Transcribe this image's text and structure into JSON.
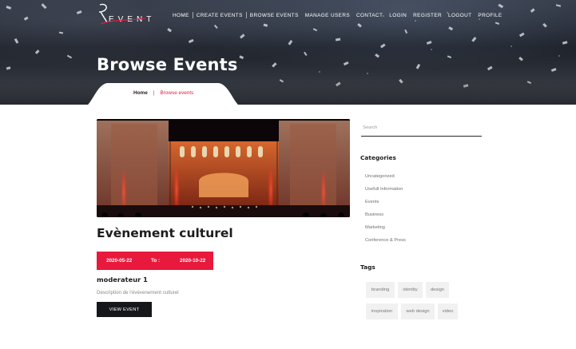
{
  "header": {
    "logo_text": "EVENT",
    "nav": [
      {
        "label": "Home"
      },
      {
        "label": "Create Events"
      },
      {
        "label": "Browse Events"
      },
      {
        "label": "Manage Users"
      },
      {
        "label": "Contact"
      },
      {
        "label": "Login"
      },
      {
        "label": "Register"
      },
      {
        "label": "Logout"
      },
      {
        "label": "Profile"
      }
    ],
    "page_title": "Browse Events",
    "breadcrumb": {
      "home": "Home",
      "separator": "|",
      "current": "Browse events"
    }
  },
  "event": {
    "title": "Evènement culturel",
    "date_start": "2020-05-22",
    "to_label": "To :",
    "date_end": "2020-10-22",
    "moderator": "moderateur 1",
    "description": "Description de l'évévenement culturel",
    "view_button": "View Event",
    "image_icon": "concert-stage-photo"
  },
  "sidebar": {
    "search_placeholder": "Search",
    "categories_heading": "Categories",
    "categories": [
      "Uncategorized",
      "Usefull Information",
      "Events",
      "Business",
      "Marketing",
      "Conference & Press"
    ],
    "tags_heading": "Tags",
    "tags": [
      "branding",
      "identity",
      "design",
      "inspiration",
      "web design",
      "video"
    ]
  },
  "colors": {
    "accent": "#e8193c",
    "button_dark": "#15171b",
    "tag_bg": "#f1f1f1"
  }
}
